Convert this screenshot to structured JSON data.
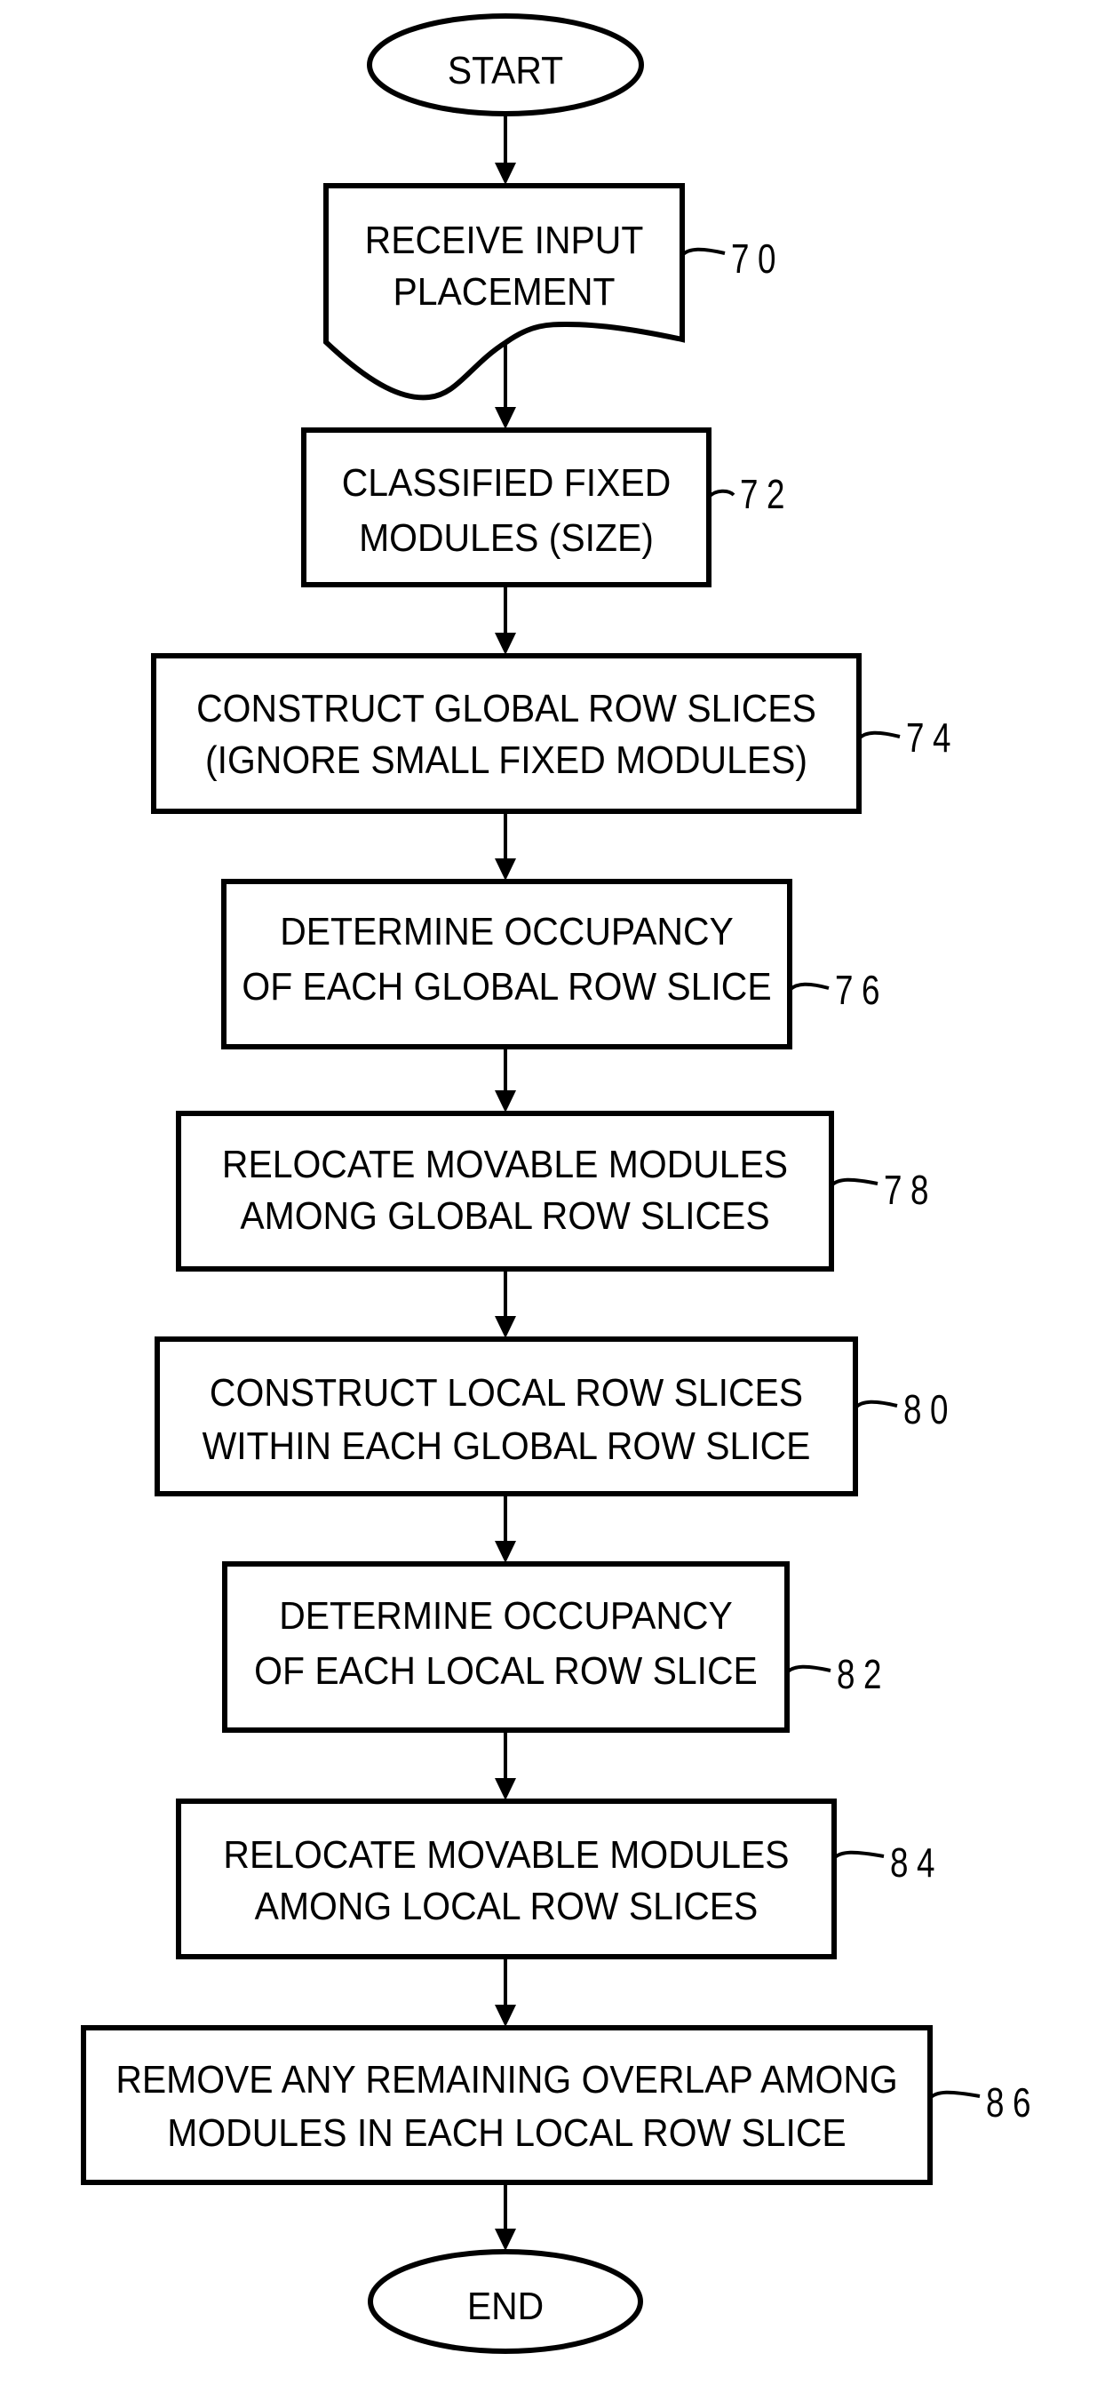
{
  "figure": {
    "type": "flowchart",
    "colors": {
      "line": "#000000",
      "background": "#ffffff"
    },
    "start": {
      "label": "START"
    },
    "end": {
      "label": "END"
    },
    "steps": [
      {
        "ref": "70",
        "shape": "document",
        "lines": [
          "RECEIVE INPUT",
          "PLACEMENT"
        ]
      },
      {
        "ref": "72",
        "shape": "process",
        "lines": [
          "CLASSIFIED FIXED",
          "MODULES (SIZE)"
        ]
      },
      {
        "ref": "74",
        "shape": "process",
        "lines": [
          "CONSTRUCT GLOBAL ROW SLICES",
          "(IGNORE SMALL FIXED MODULES)"
        ]
      },
      {
        "ref": "76",
        "shape": "process",
        "lines": [
          "DETERMINE OCCUPANCY",
          "OF EACH GLOBAL ROW SLICE"
        ]
      },
      {
        "ref": "78",
        "shape": "process",
        "lines": [
          "RELOCATE MOVABLE MODULES",
          "AMONG GLOBAL ROW SLICES"
        ]
      },
      {
        "ref": "80",
        "shape": "process",
        "lines": [
          "CONSTRUCT LOCAL ROW SLICES",
          "WITHIN EACH GLOBAL ROW SLICE"
        ]
      },
      {
        "ref": "82",
        "shape": "process",
        "lines": [
          "DETERMINE OCCUPANCY",
          "OF EACH LOCAL ROW SLICE"
        ]
      },
      {
        "ref": "84",
        "shape": "process",
        "lines": [
          "RELOCATE MOVABLE MODULES",
          "AMONG LOCAL ROW SLICES"
        ]
      },
      {
        "ref": "86",
        "shape": "process",
        "lines": [
          "REMOVE ANY REMAINING OVERLAP AMONG",
          "MODULES IN EACH LOCAL ROW SLICE"
        ]
      }
    ]
  }
}
